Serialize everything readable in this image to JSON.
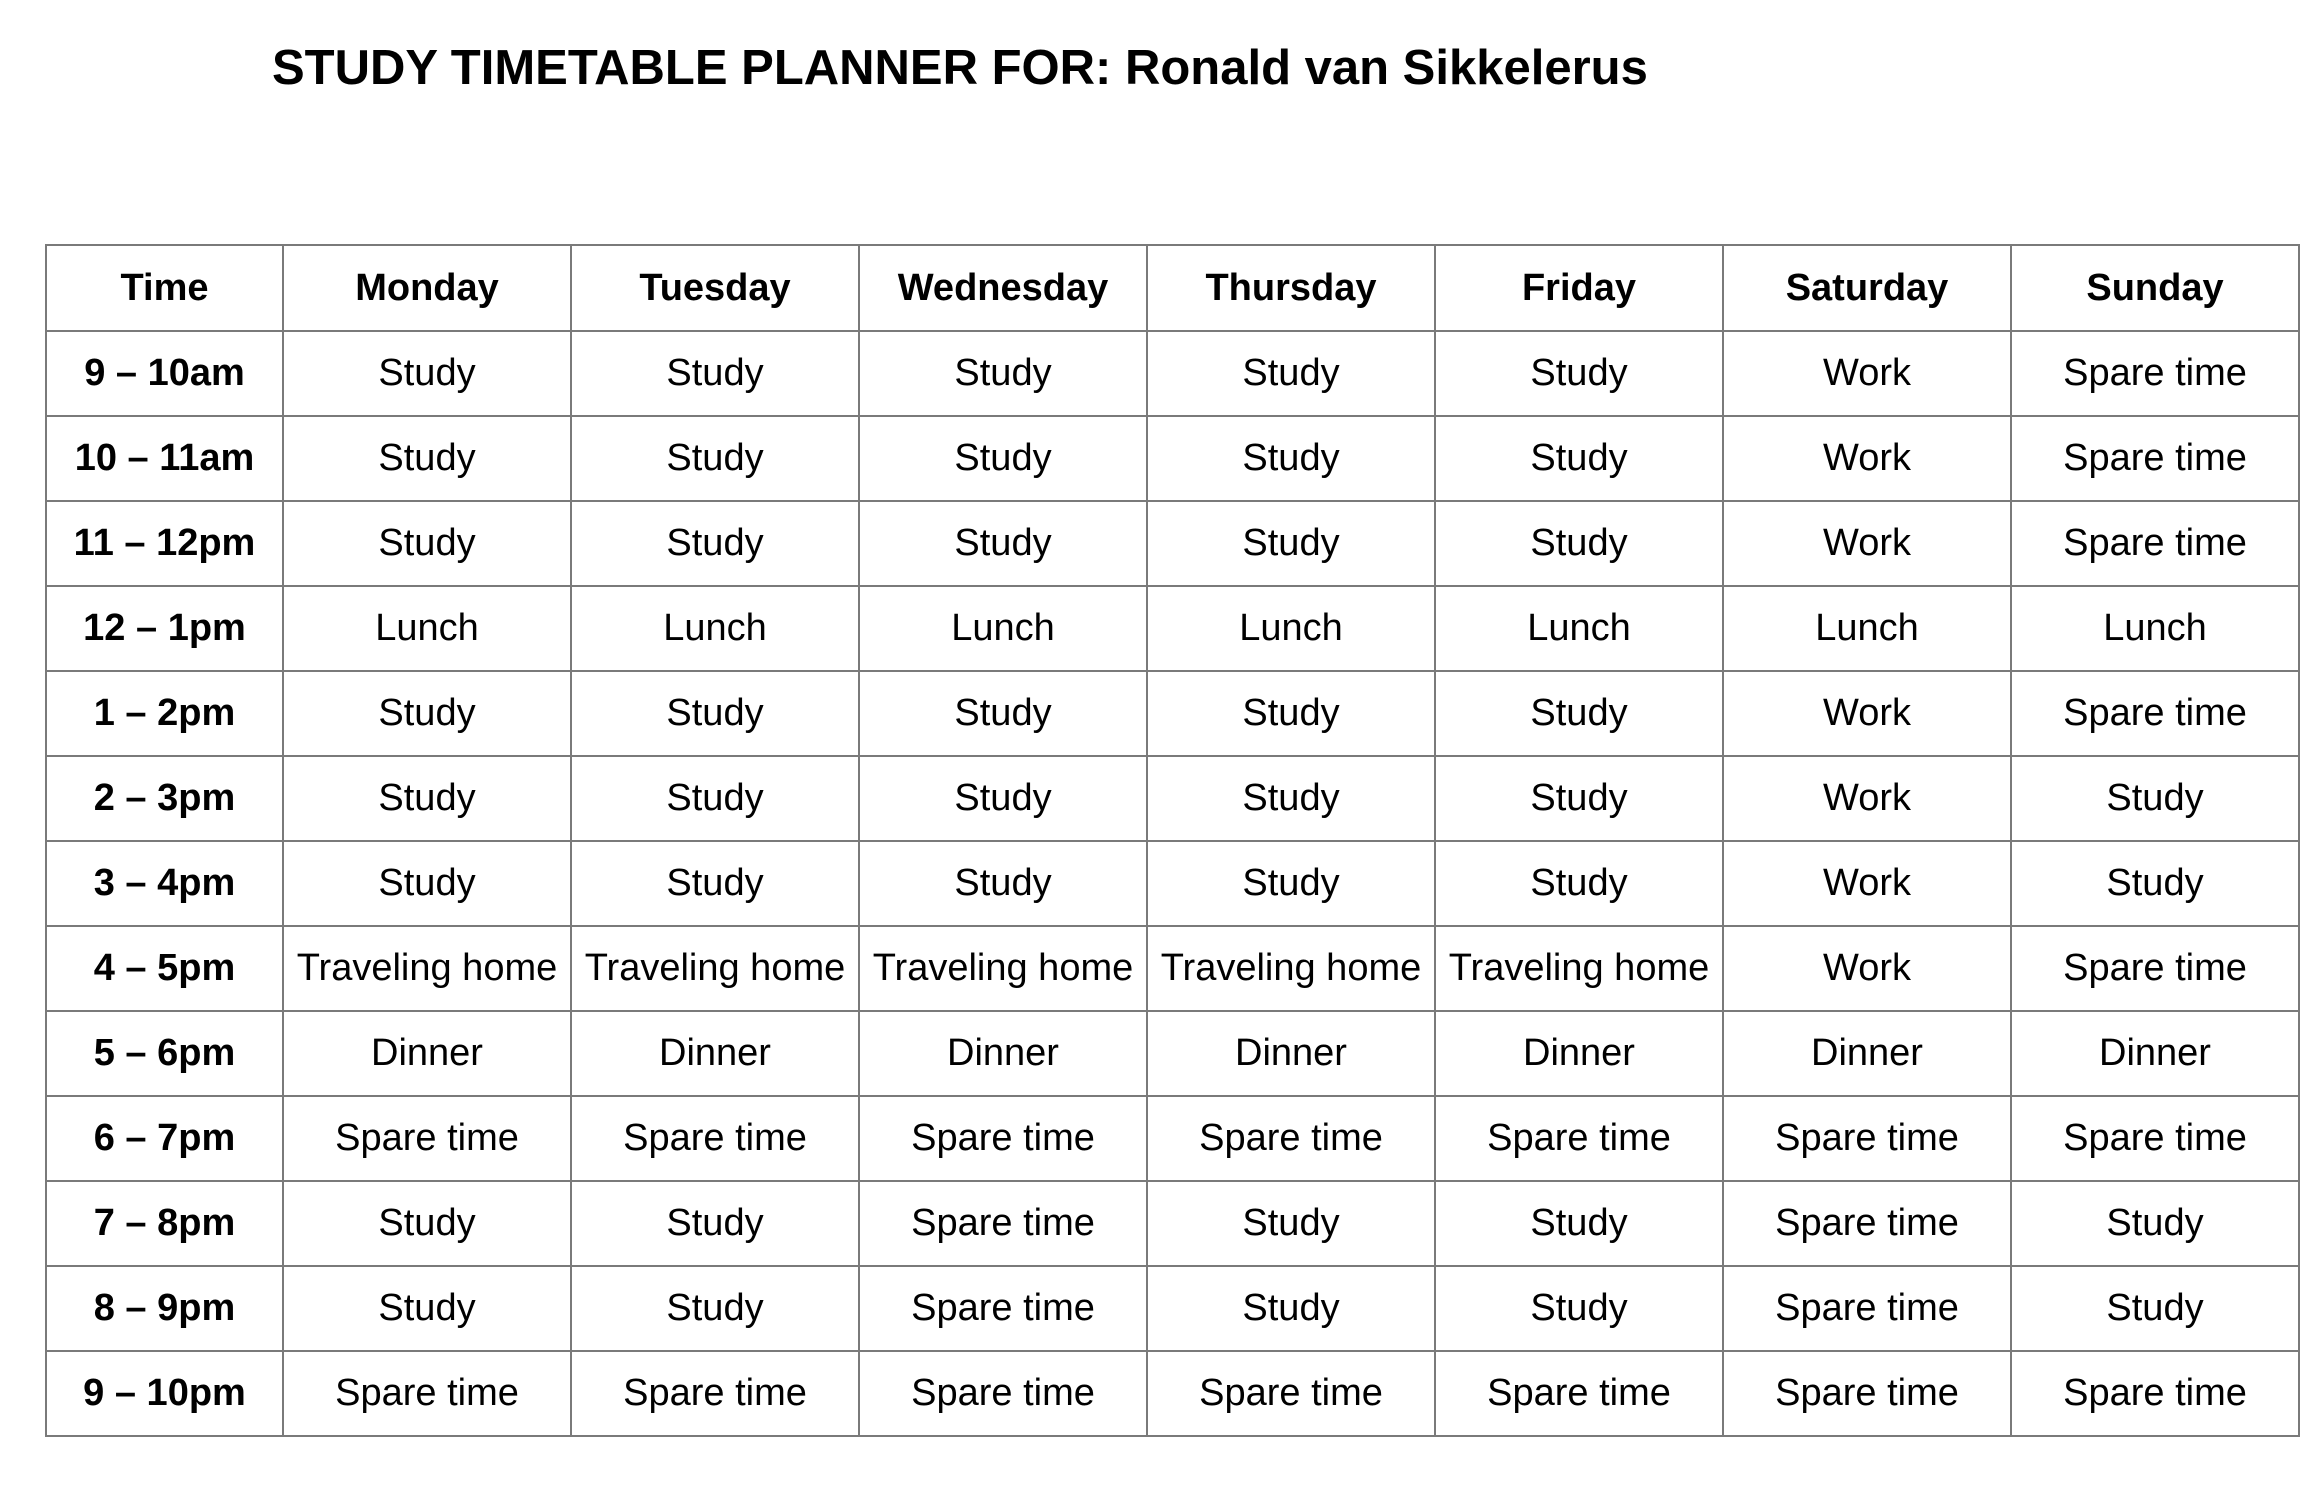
{
  "title": "STUDY TIMETABLE PLANNER FOR: Ronald van Sikkelerus",
  "table": {
    "headers": [
      "Time",
      "Monday",
      "Tuesday",
      "Wednesday",
      "Thursday",
      "Friday",
      "Saturday",
      "Sunday"
    ],
    "rows": [
      {
        "time": "9 – 10am",
        "cells": [
          "Study",
          "Study",
          "Study",
          "Study",
          "Study",
          "Work",
          "Spare time"
        ]
      },
      {
        "time": "10 – 11am",
        "cells": [
          "Study",
          "Study",
          "Study",
          "Study",
          "Study",
          "Work",
          "Spare time"
        ]
      },
      {
        "time": "11 – 12pm",
        "cells": [
          "Study",
          "Study",
          "Study",
          "Study",
          "Study",
          "Work",
          "Spare time"
        ]
      },
      {
        "time": "12 – 1pm",
        "cells": [
          "Lunch",
          "Lunch",
          "Lunch",
          "Lunch",
          "Lunch",
          "Lunch",
          "Lunch"
        ]
      },
      {
        "time": "1 – 2pm",
        "cells": [
          "Study",
          "Study",
          "Study",
          "Study",
          "Study",
          "Work",
          "Spare time"
        ]
      },
      {
        "time": "2 – 3pm",
        "cells": [
          "Study",
          "Study",
          "Study",
          "Study",
          "Study",
          "Work",
          "Study"
        ]
      },
      {
        "time": "3 – 4pm",
        "cells": [
          "Study",
          "Study",
          "Study",
          "Study",
          "Study",
          "Work",
          "Study"
        ]
      },
      {
        "time": "4 – 5pm",
        "cells": [
          "Traveling home",
          "Traveling home",
          "Traveling home",
          "Traveling home",
          "Traveling home",
          "Work",
          "Spare time"
        ]
      },
      {
        "time": "5 – 6pm",
        "cells": [
          "Dinner",
          "Dinner",
          "Dinner",
          "Dinner",
          "Dinner",
          "Dinner",
          "Dinner"
        ]
      },
      {
        "time": "6 – 7pm",
        "cells": [
          "Spare time",
          "Spare time",
          "Spare time",
          "Spare time",
          "Spare time",
          "Spare time",
          "Spare time"
        ]
      },
      {
        "time": "7 – 8pm",
        "cells": [
          "Study",
          "Study",
          "Spare time",
          "Study",
          "Study",
          "Spare time",
          "Study"
        ]
      },
      {
        "time": "8 – 9pm",
        "cells": [
          "Study",
          "Study",
          "Spare time",
          "Study",
          "Study",
          "Spare time",
          "Study"
        ]
      },
      {
        "time": "9 – 10pm",
        "cells": [
          "Spare time",
          "Spare time",
          "Spare time",
          "Spare time",
          "Spare time",
          "Spare time",
          "Spare time"
        ]
      }
    ]
  }
}
